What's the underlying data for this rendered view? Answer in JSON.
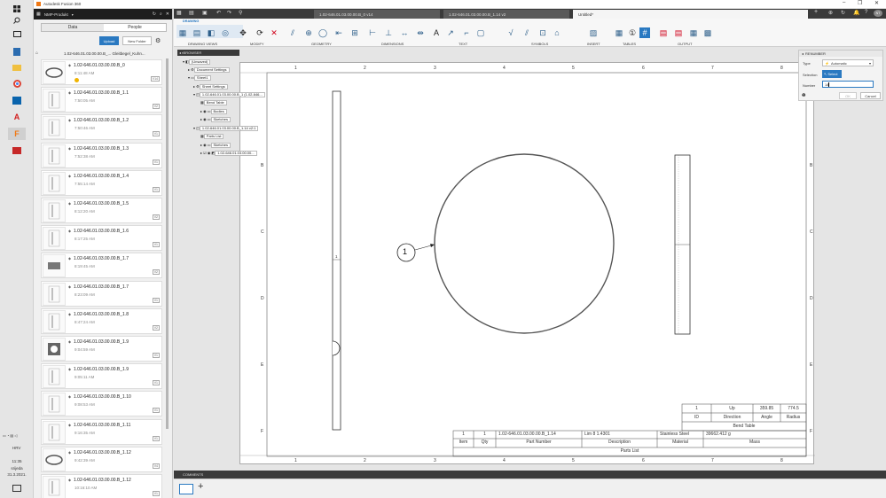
{
  "app": {
    "title": "Autodesk Fusion 360"
  },
  "taskbar": {
    "lang": "HRV",
    "time": "11:35",
    "day": "srijeda",
    "date": "31.3.2021."
  },
  "left_panel": {
    "project": "NMP-Produkt",
    "tab_data": "Data",
    "tab_people": "People",
    "upload": "Upload",
    "new_folder": "New Folder",
    "breadcrumb": "1.02-646.01.03.00.00.B_... Gleitbegel_Kuhn...",
    "files": [
      {
        "name": "1.02-646.01.03.00.00.B_0",
        "time": "8:11:48 AM",
        "ver": "V14"
      },
      {
        "name": "1.02-646.01.03.00.00.B_1.1",
        "time": "7:50:05 AM",
        "ver": "V2"
      },
      {
        "name": "1.02-646.01.03.00.00.B_1.2",
        "time": "7:50:46 AM",
        "ver": "V1"
      },
      {
        "name": "1.02-646.01.03.00.00.B_1.3",
        "time": "7:52:38 AM",
        "ver": "V1"
      },
      {
        "name": "1.02-646.01.03.00.00.B_1.4",
        "time": "7:55:14 AM",
        "ver": "V1"
      },
      {
        "name": "1.02-646.01.03.00.00.B_1.5",
        "time": "8:12:20 AM",
        "ver": "V2"
      },
      {
        "name": "1.02-646.01.03.00.00.B_1.6",
        "time": "8:17:25 AM",
        "ver": "V1"
      },
      {
        "name": "1.02-646.01.03.00.00.B_1.7",
        "time": "8:19:45 AM",
        "ver": "V2"
      },
      {
        "name": "1.02-646.01.03.00.00.B_1.7",
        "time": "8:23:09 AM",
        "ver": "V1"
      },
      {
        "name": "1.02-646.01.03.00.00.B_1.8",
        "time": "8:47:24 AM",
        "ver": "V2"
      },
      {
        "name": "1.02-646.01.03.00.00.B_1.9",
        "time": "9:04:59 AM",
        "ver": "V1"
      },
      {
        "name": "1.02-646.01.03.00.00.B_1.9",
        "time": "9:05:11 AM",
        "ver": "V1"
      },
      {
        "name": "1.02-646.01.03.00.00.B_1.10",
        "time": "9:08:53 AM",
        "ver": "V1"
      },
      {
        "name": "1.02-646.01.03.00.00.B_1.11",
        "time": "9:16:35 AM",
        "ver": "V1"
      },
      {
        "name": "1.02-646.01.03.00.00.B_1.12",
        "time": "9:42:39 AM",
        "ver": "V4"
      },
      {
        "name": "1.02-646.01.03.00.00.B_1.12",
        "time": "10:16:10 AM",
        "ver": "V1"
      }
    ]
  },
  "tabs": [
    "1.02-646.01.03.00.00.B_0 v14",
    "1.02-646.01.03.00.00.B_1.14 v2",
    "Untitled*"
  ],
  "ribbon": {
    "workspace": "DRAWING",
    "groups": [
      "DRAWING VIEWS",
      "MODIFY",
      "GEOMETRY",
      "DIMENSIONS",
      "TEXT",
      "SYMBOLS",
      "INSERT",
      "TABLES",
      "OUTPUT"
    ]
  },
  "browser": {
    "title": "BROWSER",
    "items": [
      "(Unsaved)",
      "Document Settings",
      "Sheet1",
      "Sheet Settings",
      "1.02-646.01.03.00.00.B_1 (1.02-646...",
      "Bend Table",
      "Bodies",
      "Sketches",
      "1.02-646.01.03.00.00.B_1.14 v2:1",
      "Parts List",
      "Sketches",
      "1.02-646.01.03.00.00..."
    ]
  },
  "sheet": {
    "cols": [
      "1",
      "2",
      "3",
      "4",
      "5",
      "6",
      "7",
      "8"
    ],
    "rows": [
      "B",
      "C",
      "D",
      "E",
      "F"
    ],
    "balloon": "1",
    "view_label": "1"
  },
  "bend_table": {
    "rows": [
      [
        "1",
        "Up",
        "359.85",
        "774.5"
      ],
      [
        "ID",
        "Direction",
        "Angle",
        "Radius"
      ]
    ],
    "title": "Bend Table"
  },
  "parts_list": {
    "row": [
      "1",
      "1",
      "1.02-646.01.03.00.00.B_1.14",
      "Lim 8 1.4301",
      "Stainless Steel",
      "39662.412 g"
    ],
    "header": [
      "Item",
      "Qty",
      "Part Number",
      "Description",
      "Material",
      "Mass"
    ],
    "title": "Parts List"
  },
  "renumber": {
    "title": "RENUMBER",
    "type_label": "Type",
    "type_value": "Automatic",
    "selection_label": "Selection",
    "select_btn": "Select",
    "number_label": "Number",
    "number_value": "14",
    "ok": "OK",
    "cancel": "Cancel"
  },
  "comments": {
    "label": "COMMENTS"
  }
}
